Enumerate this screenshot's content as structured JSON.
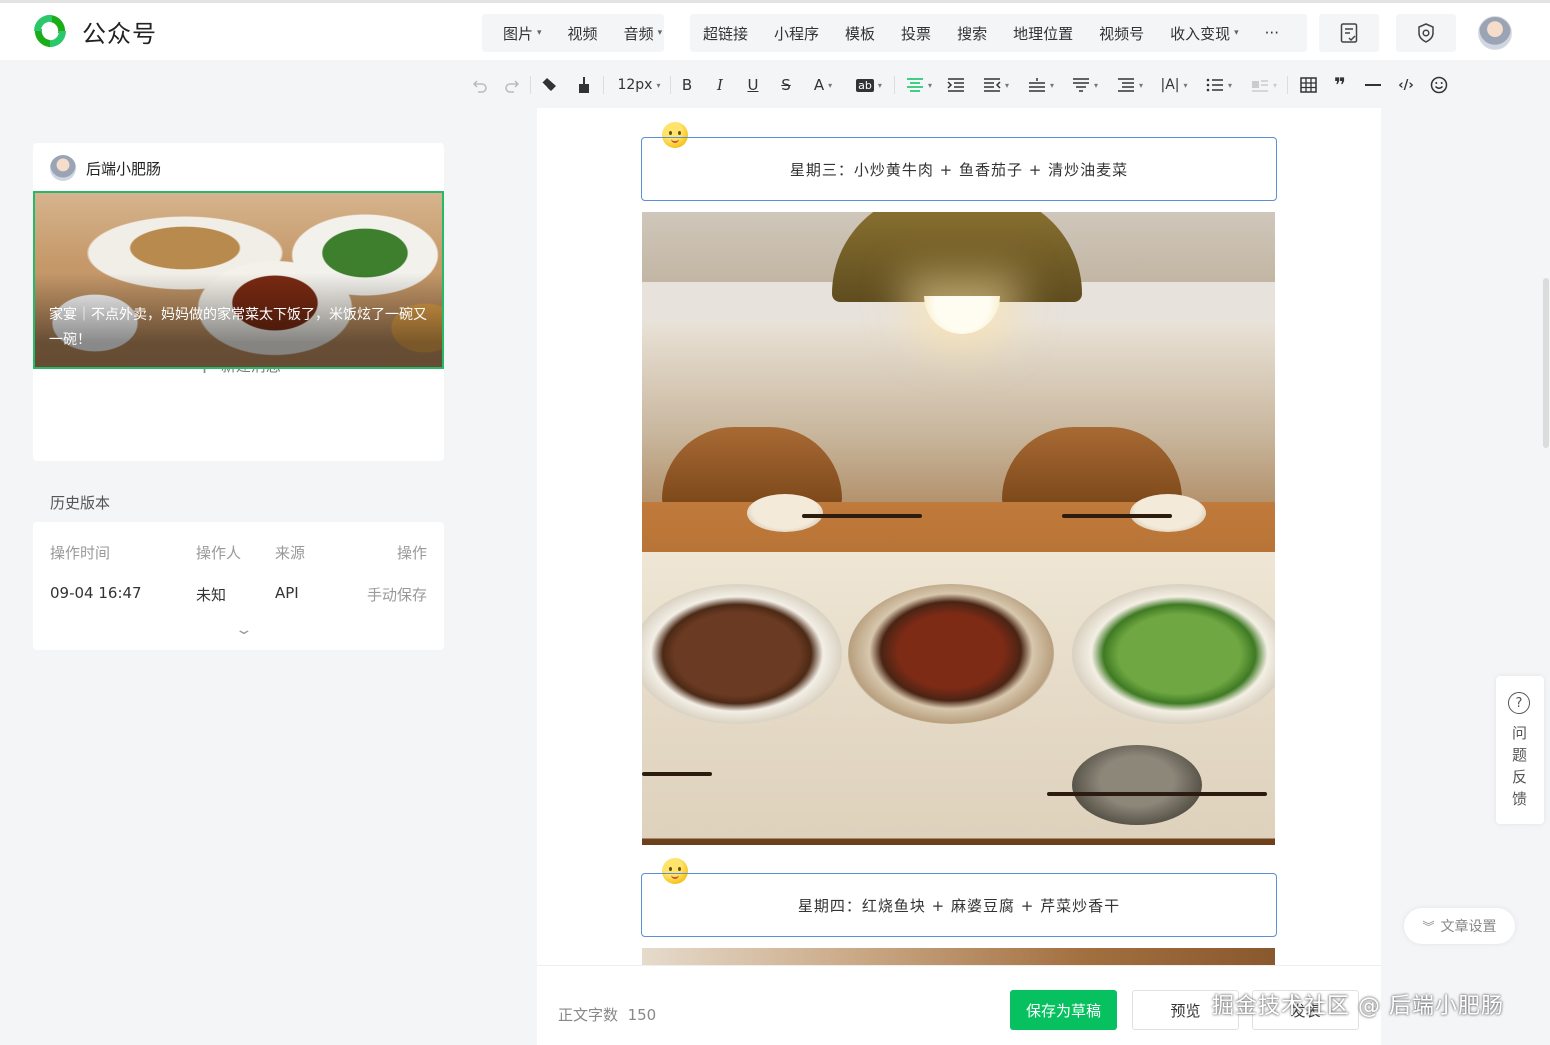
{
  "app": {
    "name": "公众号",
    "brand_color": "#07c160"
  },
  "top_toolbar": {
    "group1": [
      {
        "label": "图片",
        "caret": true
      },
      {
        "label": "视频",
        "caret": false
      },
      {
        "label": "音频",
        "caret": true
      }
    ],
    "group2": [
      {
        "label": "超链接",
        "caret": false
      },
      {
        "label": "小程序",
        "caret": false
      },
      {
        "label": "模板",
        "caret": false
      },
      {
        "label": "投票",
        "caret": false
      },
      {
        "label": "搜索",
        "caret": false
      },
      {
        "label": "地理位置",
        "caret": false
      },
      {
        "label": "视频号",
        "caret": false
      },
      {
        "label": "收入变现",
        "caret": true
      },
      {
        "label": "···",
        "caret": false
      }
    ],
    "icons": [
      "document-check-icon",
      "shield-icon",
      "user-avatar"
    ]
  },
  "format_toolbar": {
    "font_size": "12px",
    "items": [
      "undo-icon",
      "redo-icon",
      "format-clear-icon",
      "format-painter-icon",
      "bold-icon",
      "italic-icon",
      "underline-icon",
      "strikethrough-icon",
      "font-color-icon",
      "background-color-icon",
      "align-center-icon",
      "indent-icon",
      "outdent-icon",
      "line-height-icon",
      "paragraph-spacing-icon",
      "list-indent-icon",
      "letter-spacing-icon",
      "bullet-list-icon",
      "float-icon",
      "table-icon",
      "quote-icon",
      "horizontal-rule-icon",
      "code-icon",
      "emoji-icon"
    ],
    "glyphs": {
      "bold": "B",
      "italic": "I",
      "underline": "U",
      "strike": "S",
      "font_color": "A",
      "bg_color": "ab"
    }
  },
  "left_panel": {
    "author": "后端小肥肠",
    "cover_title": "家宴｜不点外卖，妈妈做的家常菜太下饭了，米饭炫了一碗又一碗！",
    "new_message": "新建消息",
    "history": {
      "title": "历史版本",
      "columns": [
        "操作时间",
        "操作人",
        "来源",
        "操作"
      ],
      "rows": [
        {
          "time": "09-04 16:47",
          "operator": "未知",
          "source": "API",
          "action": "手动保存"
        }
      ]
    }
  },
  "editor": {
    "days": [
      {
        "text": "星期三：小炒黄牛肉 + 鱼香茄子 + 清炒油麦菜"
      },
      {
        "text": "星期四：红烧鱼块 + 麻婆豆腐 + 芹菜炒香干"
      }
    ]
  },
  "bottom_bar": {
    "word_count_label": "正文字数",
    "word_count": "150",
    "save_label": "保存为草稿",
    "preview_label": "预览",
    "publish_label": "发表"
  },
  "watermark": "掘金技术社区 @ 后端小肥肠",
  "right_float": {
    "feedback_label": "问题反馈",
    "settings_label": "文章设置"
  }
}
